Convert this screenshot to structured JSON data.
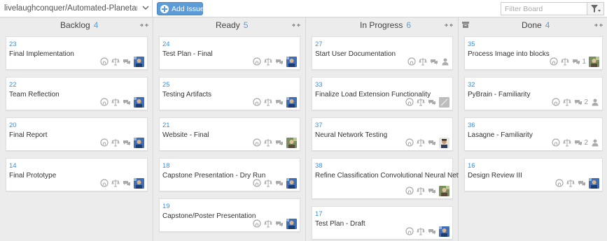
{
  "topbar": {
    "repo": "livelaughconquer/Automated-Planetary-...",
    "add_issue": "Add Issue",
    "filter_placeholder": "Filter Board"
  },
  "columns": [
    {
      "name": "Backlog",
      "count": "4",
      "cards": [
        {
          "num": "23",
          "title": "Final Implementation",
          "avatar": "blue"
        },
        {
          "num": "22",
          "title": "Team Reflection",
          "avatar": "blue"
        },
        {
          "num": "20",
          "title": "Final Report",
          "avatar": "blue"
        },
        {
          "num": "14",
          "title": "Final Prototype",
          "avatar": "blue"
        }
      ]
    },
    {
      "name": "Ready",
      "count": "5",
      "cards": [
        {
          "num": "24",
          "title": "Test Plan - Final",
          "avatar": "blue"
        },
        {
          "num": "25",
          "title": "Testing Artifacts",
          "avatar": "blue"
        },
        {
          "num": "21",
          "title": "Website - Final",
          "avatar": "green"
        },
        {
          "num": "18",
          "title": "Capstone Presentation - Dry Run",
          "avatar": "blue"
        },
        {
          "num": "19",
          "title": "Capstone/Poster Presentation",
          "avatar": "blue"
        }
      ]
    },
    {
      "name": "In Progress",
      "count": "6",
      "cards": [
        {
          "num": "27",
          "title": "Start User Documentation",
          "avatar": "none"
        },
        {
          "num": "33",
          "title": "Finalize Load Extension Functionality",
          "avatar": "gray"
        },
        {
          "num": "37",
          "title": "Neural Network Testing",
          "avatar": "person"
        },
        {
          "num": "38",
          "title": "Refine Classification Convolutional Neural Network",
          "avatar": "green"
        },
        {
          "num": "17",
          "title": "Test Plan - Draft",
          "avatar": "blue"
        }
      ]
    },
    {
      "name": "Done",
      "count": "4",
      "cards": [
        {
          "num": "35",
          "title": "Process Image into blocks",
          "comments": "1",
          "avatar": "green"
        },
        {
          "num": "32",
          "title": "PyBrain - Familiarity",
          "comments": "2",
          "avatar": "none"
        },
        {
          "num": "36",
          "title": "Lasagne - Familiarity",
          "comments": "2",
          "avatar": "none"
        },
        {
          "num": "16",
          "title": "Design Review III",
          "avatar": "blue"
        }
      ]
    }
  ],
  "colors": {
    "accent": "#5a9bd8",
    "number": "#3b8fd4",
    "count": "#5aa0dc"
  },
  "icon_names": [
    "github-icon",
    "scale-icon",
    "comments-icon",
    "user-icon",
    "filter-icon",
    "collapse-icon",
    "archive-icon"
  ]
}
